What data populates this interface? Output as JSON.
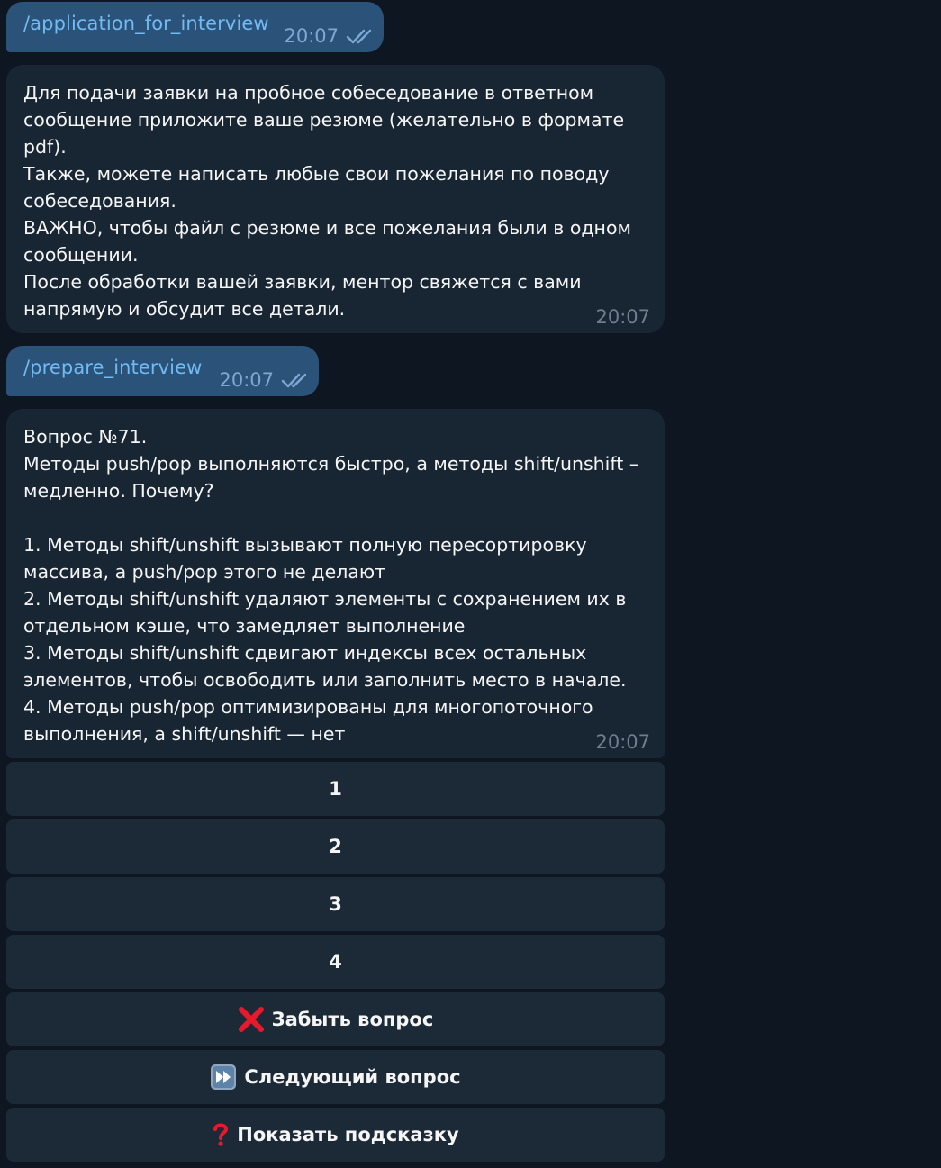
{
  "messages": {
    "out1": {
      "text": "/application_for_interview",
      "time": "20:07"
    },
    "in1": {
      "text": "Для подачи заявки на пробное собеседование в ответном\nсообщение приложите ваше резюме (желательно в формате\npdf).\nТакже, можете написать любые свои пожелания по поводу\nсобеседования.\nВАЖНО, чтобы файл с резюме и все пожелания были в одном\nсообщении.\nПосле обработки вашей заявки, ментор свяжется с вами\nнапрямую и обсудит все детали.",
      "time": "20:07"
    },
    "out2": {
      "text": "/prepare_interview",
      "time": "20:07"
    },
    "in2": {
      "text": "Вопрос №71.\nМетоды push/pop выполняются быстро, а методы shift/unshift –\nмедленно. Почему?\n\n1. Методы shift/unshift вызывают полную пересортировку\nмассива, а push/pop этого не делают\n2. Методы shift/unshift удаляют элементы с сохранением их в\nотдельном кэше, что замедляет выполнение\n3. Методы shift/unshift сдвигают индексы всех остальных\nэлементов, чтобы освободить или заполнить место в начале.\n4. Методы push/pop оптимизированы для многопоточного\nвыполнения, а shift/unshift — нет",
      "time": "20:07"
    }
  },
  "keyboard": {
    "answer_1": "1",
    "answer_2": "2",
    "answer_3": "3",
    "answer_4": "4",
    "forget": {
      "label": "Забыть вопрос",
      "icon": "cross-mark-icon"
    },
    "next": {
      "label": "Следующий вопрос",
      "icon": "fast-forward-icon"
    },
    "hint": {
      "label": "Показать подсказку",
      "icon": "question-mark-icon"
    }
  },
  "colors": {
    "background": "#0e1621",
    "outgoing_bubble": "#2b5278",
    "incoming_bubble": "#182533",
    "command_link": "#71baf2",
    "keyboard_button": "#1c2a38"
  }
}
